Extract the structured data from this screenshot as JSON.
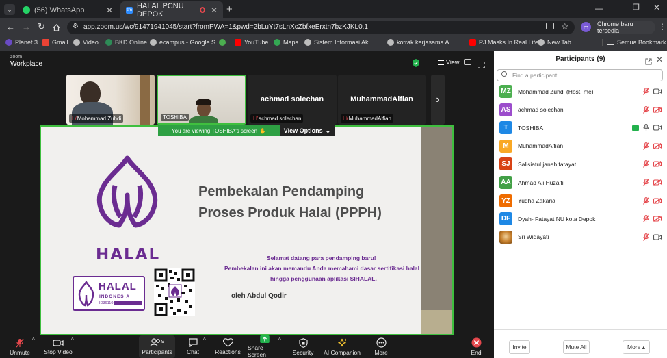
{
  "browser": {
    "tabs": [
      {
        "label": "(56) WhatsApp"
      },
      {
        "label": "HALAL PCNU DEPOK"
      }
    ],
    "url": "app.zoom.us/wc/91471941045/start?fromPWA=1&pwd=2bLuYt7sLnXcZbfxeErxtn7bzKJKL0.1",
    "profile_initial": "m",
    "chrome_update_label": "Chrome baru tersedia",
    "bookmarks": [
      {
        "label": "Planet 3",
        "color": "#6a4bc4"
      },
      {
        "label": "Gmail",
        "color": "#ea4335"
      },
      {
        "label": "Video",
        "color": "#bdbdbd"
      },
      {
        "label": "BKD Online",
        "color": "#2e8b57"
      },
      {
        "label": "ecampus - Google S...",
        "color": "#bdbdbd"
      },
      {
        "label": "",
        "color": "#4caf50"
      },
      {
        "label": "YouTube",
        "color": "#ff0000"
      },
      {
        "label": "Maps",
        "color": "#34a853"
      },
      {
        "label": "Sistem Informasi Ak...",
        "color": "#bdbdbd"
      },
      {
        "label": "kotrak kerjasama A...",
        "color": "#bdbdbd"
      },
      {
        "label": "PJ Masks In Real Life...",
        "color": "#ff0000"
      },
      {
        "label": "New Tab",
        "color": "#bdbdbd"
      }
    ],
    "all_bookmarks_label": "Semua Bookmark"
  },
  "zoom": {
    "brand_line1": "zoom",
    "brand_line2": "Workplace",
    "view_label": "View",
    "thumbnails": [
      {
        "name": "Mohammad Zuhdi",
        "type": "video"
      },
      {
        "name": "TOSHIBA",
        "type": "video"
      },
      {
        "name": "achmad solechan",
        "type": "name"
      },
      {
        "name": "MuhammadAlfian",
        "type": "name"
      }
    ],
    "share_banner": {
      "text": "You are viewing  TOSHIBA's screen",
      "view_options_label": "View Options"
    },
    "slide": {
      "title_line1": "Pembekalan Pendamping",
      "title_line2": "Proses Produk Halal (PPPH)",
      "welcome": "Selamat datang para pendamping baru!",
      "desc_line1": "Pembekalan ini akan memandu Anda memahami dasar sertifikasi halal",
      "desc_line2": "hingga penggunaan aplikasi SIHALAL.",
      "author": "oleh Abdul Qodir",
      "logo_text": "HALAL",
      "badge_line1": "HALAL",
      "badge_line2": "INDONESIA",
      "badge_code": "ID36110",
      "purple": "#6b2c91"
    },
    "toolbar": [
      {
        "label": "Unmute",
        "icon": "mic-off-icon"
      },
      {
        "label": "Stop Video",
        "icon": "video-icon"
      },
      {
        "label": "Participants",
        "icon": "participants-icon",
        "badge": "9"
      },
      {
        "label": "Chat",
        "icon": "chat-icon"
      },
      {
        "label": "Reactions",
        "icon": "heart-icon"
      },
      {
        "label": "Share Screen",
        "icon": "share-screen-icon"
      },
      {
        "label": "Security",
        "icon": "shield-icon"
      },
      {
        "label": "AI Companion",
        "icon": "sparkle-icon"
      },
      {
        "label": "More",
        "icon": "more-icon"
      },
      {
        "label": "End",
        "icon": "end-icon"
      }
    ]
  },
  "participants": {
    "title": "Participants (9)",
    "search_placeholder": "Find a participant",
    "list": [
      {
        "initials": "MZ",
        "name": "Mohammad Zuhdi (Host, me)",
        "color": "#4caf50",
        "video": "on"
      },
      {
        "initials": "AS",
        "name": "achmad solechan",
        "color": "#9c4dcc",
        "video": "off"
      },
      {
        "initials": "T",
        "name": "TOSHIBA",
        "color": "#1e88e5",
        "video": "on",
        "mic": "on",
        "sharing": true
      },
      {
        "initials": "M",
        "name": "MuhammadAlfian",
        "color": "#f9a825",
        "video": "off"
      },
      {
        "initials": "SJ",
        "name": "Salisiatul janah fatayat",
        "color": "#d84315",
        "video": "off"
      },
      {
        "initials": "AA",
        "name": "Ahmad Ali Huzaifi",
        "color": "#43a047",
        "video": "off"
      },
      {
        "initials": "YZ",
        "name": "Yudha Zakaria",
        "color": "#ef6c00",
        "video": "off"
      },
      {
        "initials": "DF",
        "name": "Dyah- Fatayat NU kota Depok",
        "color": "#1e88e5",
        "video": "off"
      },
      {
        "initials": "",
        "name": "Sri Widayati",
        "color": "#c47d2a",
        "video": "on",
        "photo": true
      }
    ],
    "buttons": {
      "invite": "Invite",
      "mute_all": "Mute All",
      "more": "More ▴"
    }
  }
}
